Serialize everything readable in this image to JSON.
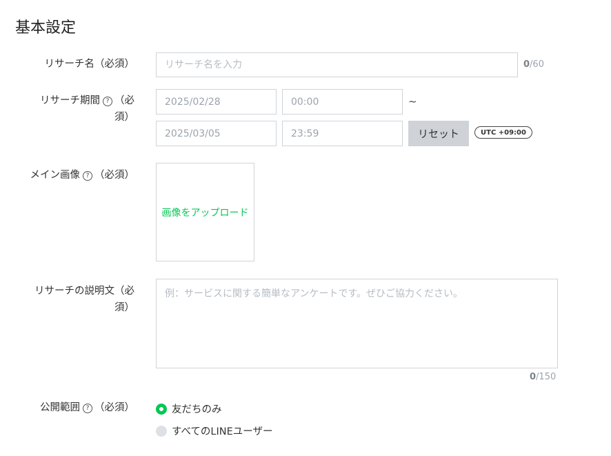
{
  "section": {
    "title": "基本設定"
  },
  "name_row": {
    "label": "リサーチ名（必須）",
    "placeholder": "リサーチ名を入力",
    "counter_current": "0",
    "counter_max": "/60"
  },
  "period_row": {
    "label_main": "リサーチ期間",
    "label_req": "（必",
    "label_req2": "須）",
    "start_date": "2025/02/28",
    "start_time": "00:00",
    "separator": "~",
    "end_date": "2025/03/05",
    "end_time": "23:59",
    "reset_label": "リセット",
    "timezone": "UTC +09:00"
  },
  "image_row": {
    "label_main": "メイン画像",
    "label_req": "（必須）",
    "upload_label": "画像をアップロード"
  },
  "description_row": {
    "label_line1": "リサーチの説明文（必",
    "label_line2": "須）",
    "placeholder": "例：サービスに関する簡単なアンケートです。ぜひご協力ください。",
    "counter_current": "0",
    "counter_max": "/150"
  },
  "visibility_row": {
    "label_main": "公開範囲",
    "label_req": "（必須）",
    "options": [
      {
        "label": "友だちのみ",
        "selected": true
      },
      {
        "label": "すべてのLINEユーザー",
        "selected": false
      }
    ]
  },
  "colors": {
    "accent": "#06c755",
    "border": "#cfd3d8",
    "button_bg": "#cfd3d8"
  },
  "icons": {
    "help": "question-circle-icon"
  }
}
